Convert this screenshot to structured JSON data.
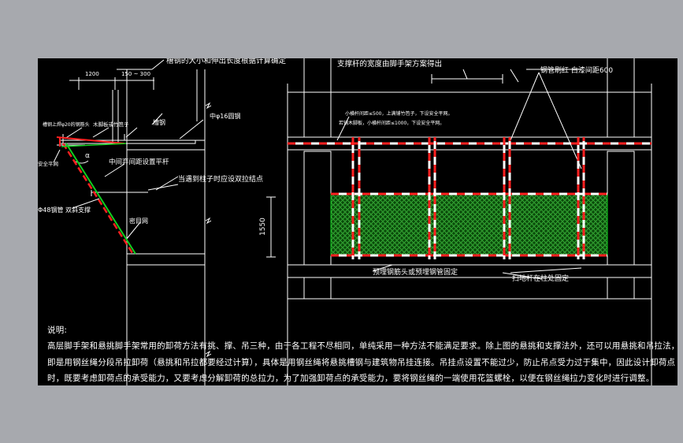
{
  "colors": {
    "bg": "#a7a9ae",
    "canvas": "#000000",
    "line": "#ffffff",
    "red": "#ff2020",
    "green": "#10d020",
    "net": "#3fbf3f"
  },
  "left": {
    "dim_a": "1200",
    "dim_b": "150 ~ 300",
    "note_top": "槽钢的大小和伸出长度根据计算确定",
    "label_channel_tie": "槽钢上焊φ20的钢筋头",
    "label_plank": "木脚板或竹笆子",
    "label_channel": "槽钢",
    "label_round": "中φ16圆钢",
    "label_safety_bar": "安全平网",
    "label_mid": "中间弃间距设置平杆",
    "label_column": "当遇到柱子时应设双拉结点",
    "label_pipe": "Φ48钢管 双斜支撑",
    "label_mesh": "密目网",
    "angle": "α"
  },
  "right": {
    "note_top": "支撑杆的宽度由脚手架方案得出",
    "label_paint": "钢管刷红 白漆间距600",
    "label_spacing_1": "小横杆间距≤500，上满铺竹笆子，下设安全平网。",
    "label_spacing_2": "若铺木脚板，小横杆间距≤1000，下设安全平网。",
    "dim_height": "1550",
    "label_embed": "预埋钢筋头或预埋钢管固定",
    "label_sweep": "扫地杆在柱处固定"
  },
  "notes": {
    "title": "说明:",
    "line1": "高层脚手架和悬挑脚手架常用的卸荷方法有挑、撑、吊三种，由于各工程不尽相同，单纯采用一种方法不能满足要求。除上图的悬挑和支撑法外，还可以用悬挑和吊拉法，",
    "line2": "即是用钢丝绳分段吊拉卸荷（悬挑和吊拉都要经过计算），具体是用钢丝绳将悬挑槽钢与建筑物吊挂连接。吊挂点设置不能过少，防止吊点受力过于集中，因此设计卸荷点",
    "line3": "时，既要考虑卸荷点的承受能力，又要考虑分解卸荷的总拉力，为了加强卸荷点的承受能力，要将钢丝绳的一端使用花篮螺栓，以便在钢丝绳拉力变化时进行调整。"
  }
}
